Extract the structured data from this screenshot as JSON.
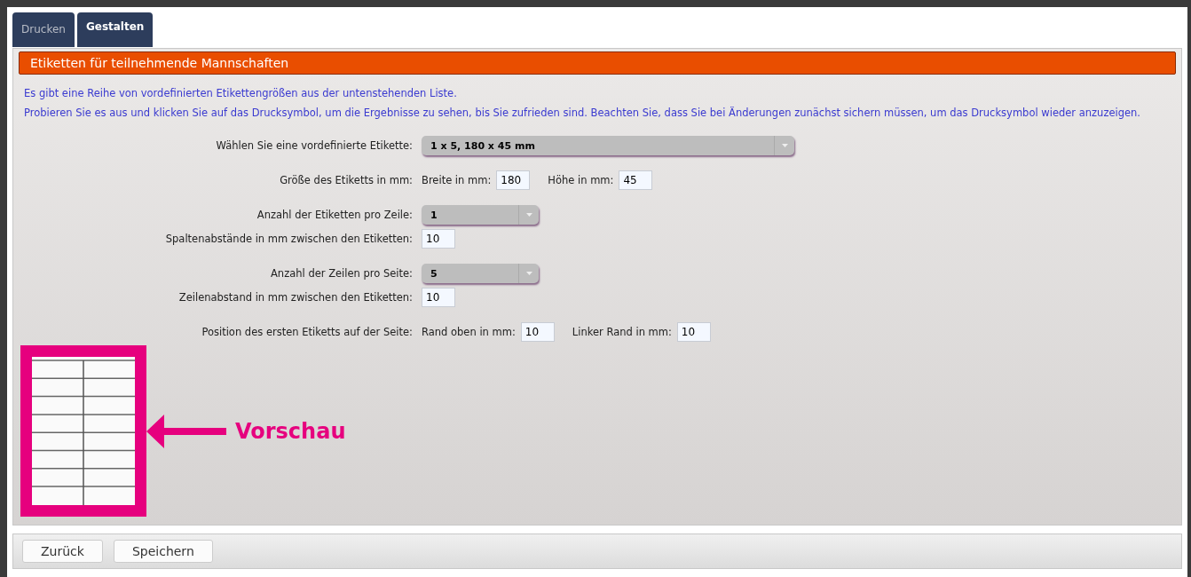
{
  "tabs": [
    {
      "label": "Drucken",
      "selected": false
    },
    {
      "label": "Gestalten",
      "selected": true
    }
  ],
  "panel": {
    "title": "Etiketten für teilnehmende Mannschaften",
    "intro": [
      "Es gibt eine Reihe von vordefinierten Etikettengrößen aus der untenstehenden Liste.",
      "Probieren Sie es aus und klicken Sie auf das Drucksymbol, um die Ergebnisse zu sehen, bis Sie zufrieden sind. Beachten Sie, dass Sie bei Änderungen zunächst sichern müssen, um das Drucksymbol wieder anzuzeigen."
    ],
    "groups": [
      [
        {
          "label": "Wählen Sie eine vordefinierte Etikette:",
          "controls": [
            {
              "kind": "list",
              "value": "1 x 5, 180 x 45 mm"
            }
          ]
        }
      ],
      [
        {
          "label": "Größe des Etiketts in mm:",
          "controls": [
            {
              "kind": "input",
              "label": "Breite in mm:",
              "value": "180"
            },
            {
              "kind": "input",
              "label": "Höhe in mm:",
              "value": "45"
            }
          ]
        }
      ],
      [
        {
          "label": "Anzahl der Etiketten pro Zeile:",
          "controls": [
            {
              "kind": "select",
              "value": "1"
            }
          ]
        },
        {
          "label": "Spaltenabstände in mm zwischen den Etiketten:",
          "controls": [
            {
              "kind": "input",
              "value": "10"
            }
          ]
        }
      ],
      [
        {
          "label": "Anzahl der Zeilen pro Seite:",
          "controls": [
            {
              "kind": "select",
              "value": "5"
            }
          ]
        },
        {
          "label": "Zeilenabstand in mm zwischen den Etiketten:",
          "controls": [
            {
              "kind": "input",
              "value": "10"
            }
          ]
        }
      ],
      [
        {
          "label": "Position des ersten Etiketts auf der Seite:",
          "controls": [
            {
              "kind": "input",
              "label": "Rand oben in mm:",
              "value": "10"
            },
            {
              "kind": "input",
              "label": "Linker Rand in mm:",
              "value": "10"
            }
          ]
        }
      ]
    ],
    "preview": {
      "annotation": "Vorschau"
    }
  },
  "buttons": [
    "Zurück",
    "Speichern"
  ]
}
